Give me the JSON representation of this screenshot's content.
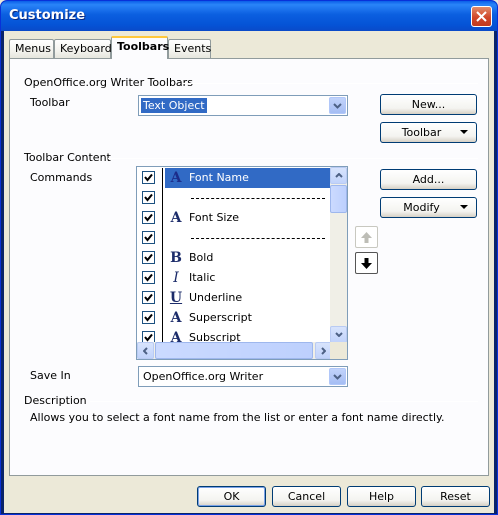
{
  "window": {
    "title": "Customize"
  },
  "tabs": [
    {
      "label": "Menus",
      "active": false
    },
    {
      "label": "Keyboard",
      "active": false
    },
    {
      "label": "Toolbars",
      "active": true
    },
    {
      "label": "Events",
      "active": false
    }
  ],
  "section_toolbars": {
    "heading": "OpenOffice.org Writer Toolbars",
    "toolbar_label": "Toolbar",
    "toolbar_value": "Text Object",
    "new_button": "New...",
    "toolbar_menu_button": "Toolbar"
  },
  "section_content": {
    "heading": "Toolbar Content",
    "commands_label": "Commands",
    "add_button": "Add...",
    "modify_button": "Modify"
  },
  "commands": [
    {
      "label": "Font Name",
      "checked": true,
      "icon": "font-name-icon",
      "separator": false,
      "selected": true
    },
    {
      "label": "",
      "checked": true,
      "icon": "",
      "separator": true,
      "selected": false
    },
    {
      "label": "Font Size",
      "checked": true,
      "icon": "font-size-icon",
      "separator": false,
      "selected": false
    },
    {
      "label": "",
      "checked": true,
      "icon": "",
      "separator": true,
      "selected": false
    },
    {
      "label": "Bold",
      "checked": true,
      "icon": "bold-icon",
      "separator": false,
      "selected": false
    },
    {
      "label": "Italic",
      "checked": true,
      "icon": "italic-icon",
      "separator": false,
      "selected": false
    },
    {
      "label": "Underline",
      "checked": true,
      "icon": "underline-icon",
      "separator": false,
      "selected": false
    },
    {
      "label": "Superscript",
      "checked": true,
      "icon": "superscript-icon",
      "separator": false,
      "selected": false
    },
    {
      "label": "Subscript",
      "checked": true,
      "icon": "subscript-icon",
      "separator": false,
      "selected": false
    }
  ],
  "save_in": {
    "label": "Save In",
    "value": "OpenOffice.org Writer"
  },
  "description": {
    "heading": "Description",
    "text": "Allows you to select a font name from the list or enter a font name directly."
  },
  "footer": {
    "ok": "OK",
    "cancel": "Cancel",
    "help": "Help",
    "reset": "Reset"
  },
  "colors": {
    "titlebar": "#0553d6",
    "selection": "#316ac5",
    "tab_highlight": "#ffc83c"
  }
}
